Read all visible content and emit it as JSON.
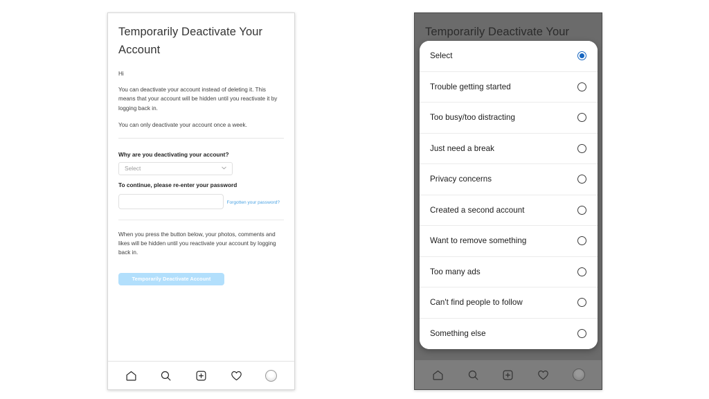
{
  "left_phone": {
    "title": "Temporarily Deactivate Your Account",
    "greeting": "Hi",
    "paragraph_1": "You can deactivate your account instead of deleting it. This means that your account will be hidden until you reactivate it by logging back in.",
    "paragraph_2": "You can only deactivate your account once a week.",
    "reason_label": "Why are you deactivating your account?",
    "reason_select_value": "Select",
    "password_label": "To continue, please re-enter your password",
    "password_value": "",
    "password_placeholder": "",
    "forgot_link": "Forgotten your password?",
    "paragraph_3": "When you press the button below, your photos, comments and likes will be hidden until you reactivate your account by logging back in.",
    "deactivate_button": "Temporarily Deactivate Account",
    "deactivate_button_color": "#b2dffc",
    "link_color": "#4ba3e3"
  },
  "right_phone": {
    "title": "Temporarily Deactivate Your",
    "scrim_color": "#6b6b6b",
    "selected_radio_color": "#1565c0",
    "options": [
      {
        "label": "Select",
        "selected": true
      },
      {
        "label": "Trouble getting started",
        "selected": false
      },
      {
        "label": "Too busy/too distracting",
        "selected": false
      },
      {
        "label": "Just need a break",
        "selected": false
      },
      {
        "label": "Privacy concerns",
        "selected": false
      },
      {
        "label": "Created a second account",
        "selected": false
      },
      {
        "label": "Want to remove something",
        "selected": false
      },
      {
        "label": "Too many ads",
        "selected": false
      },
      {
        "label": "Can't find people to follow",
        "selected": false
      },
      {
        "label": "Something else",
        "selected": false
      }
    ]
  },
  "bottom_nav": {
    "items": [
      {
        "icon": "home-icon",
        "label": "Home"
      },
      {
        "icon": "search-icon",
        "label": "Search"
      },
      {
        "icon": "plus-square-icon",
        "label": "Create"
      },
      {
        "icon": "heart-icon",
        "label": "Activity"
      },
      {
        "icon": "avatar-icon",
        "label": "Profile"
      }
    ]
  }
}
